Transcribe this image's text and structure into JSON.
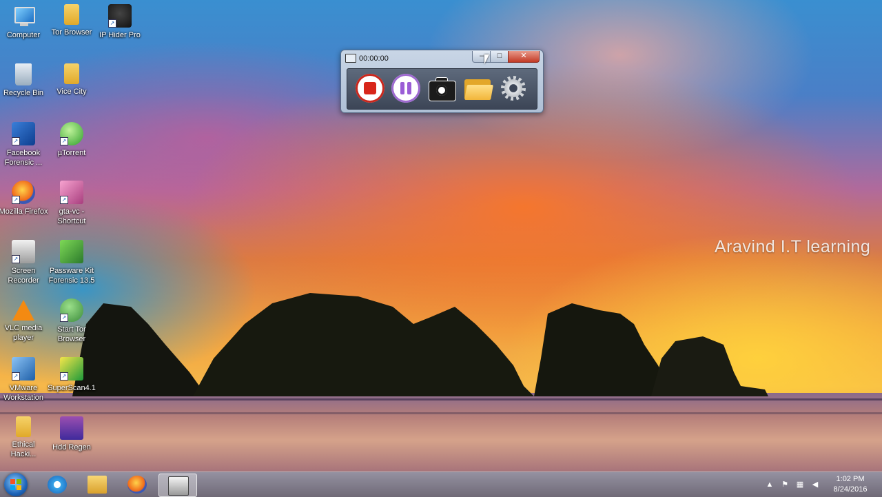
{
  "desktop": {
    "watermark": "Aravind  I.T learning",
    "icons": [
      {
        "label": "Computer",
        "icon": "computer-icon"
      },
      {
        "label": "Tor Browser",
        "icon": "folder-icon"
      },
      {
        "label": "IP Hider Pro",
        "icon": "ip-hider-icon"
      },
      {
        "label": "Recycle Bin",
        "icon": "recycle-bin-icon"
      },
      {
        "label": "Vice City",
        "icon": "folder-icon"
      },
      {
        "label": "Facebook Forensic ...",
        "icon": "facebook-forensic-icon"
      },
      {
        "label": "µTorrent",
        "icon": "utorrent-icon"
      },
      {
        "label": "Mozilla Firefox",
        "icon": "firefox-icon"
      },
      {
        "label": "gta-vc - Shortcut",
        "icon": "gta-vc-icon"
      },
      {
        "label": "Screen Recorder",
        "icon": "screen-recorder-icon"
      },
      {
        "label": "Passware Kit Forensic 13.5",
        "icon": "passware-icon"
      },
      {
        "label": "VLC media player",
        "icon": "vlc-icon"
      },
      {
        "label": "Start Tor Browser",
        "icon": "tor-icon"
      },
      {
        "label": "VMware Workstation",
        "icon": "vmware-icon"
      },
      {
        "label": "SuperScan4.1",
        "icon": "superscan-icon"
      },
      {
        "label": "Ethical Hacki...",
        "icon": "folder-icon"
      },
      {
        "label": "Hdd Regen",
        "icon": "winrar-icon"
      }
    ]
  },
  "recorder": {
    "time": "00:00:00",
    "buttons": [
      "record",
      "pause",
      "screenshot",
      "open-folder",
      "settings"
    ],
    "window_controls": {
      "minimize": "–",
      "maximize": "□",
      "close": "✕"
    }
  },
  "taskbar": {
    "pinned": [
      "internet-explorer-icon",
      "file-explorer-icon",
      "firefox-icon",
      "screen-recorder-icon"
    ],
    "active": "screen-recorder-icon",
    "tray": {
      "show_hidden": "▲"
    },
    "clock": {
      "time": "1:02 PM",
      "date": "8/24/2016"
    }
  }
}
